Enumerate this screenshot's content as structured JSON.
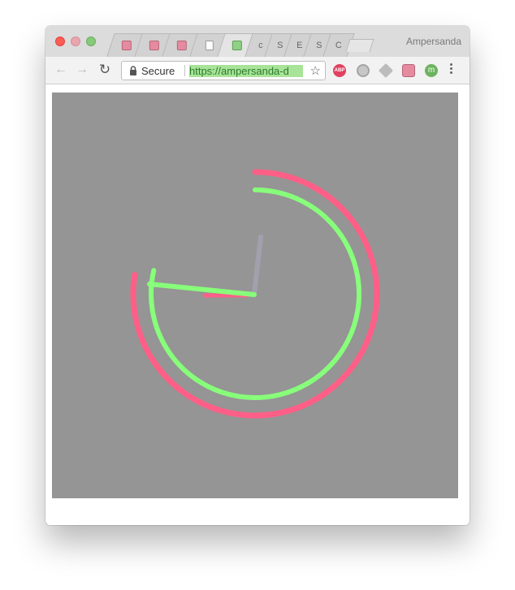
{
  "window": {
    "title": "Ampersanda"
  },
  "tabs": [
    {
      "icon": "pink-favicon"
    },
    {
      "icon": "pink-favicon"
    },
    {
      "icon": "pink-favicon"
    },
    {
      "icon": "blank-document-icon"
    },
    {
      "icon": "green-favicon"
    },
    {
      "icon": "letter-favicon",
      "letter": "c"
    },
    {
      "icon": "letter-favicon",
      "letter": "S"
    },
    {
      "icon": "letter-favicon",
      "letter": "E"
    },
    {
      "icon": "letter-favicon",
      "letter": "S"
    },
    {
      "icon": "letter-favicon",
      "letter": "C"
    }
  ],
  "toolbar": {
    "secure_label": "Secure",
    "url": "https://ampersanda-d",
    "abp_label": "ABP"
  },
  "clock": {
    "colors": {
      "outer_arc": "#ff5f87",
      "inner_arc": "#87ff7a",
      "hand_green": "#87ff7a",
      "hand_gray": "#a3a0ae",
      "background": "#959595"
    }
  }
}
